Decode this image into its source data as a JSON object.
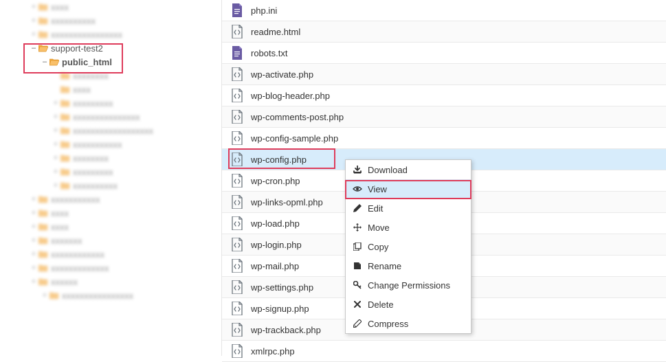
{
  "sidebar": {
    "items": [
      {
        "indent": 1,
        "toggle": "+",
        "label": "xxxx",
        "blur": true
      },
      {
        "indent": 1,
        "toggle": "+",
        "label": "xxxxxxxxxx",
        "blur": true
      },
      {
        "indent": 1,
        "toggle": "+",
        "label": "xxxxxxxxxxxxxxxx",
        "blur": true
      },
      {
        "indent": 1,
        "toggle": "–",
        "label": "support-test2",
        "blur": false,
        "open": true
      },
      {
        "indent": 2,
        "toggle": "–",
        "label": "public_html",
        "blur": false,
        "bold": true,
        "open": true
      },
      {
        "indent": 3,
        "toggle": "",
        "label": "xxxxxxxx",
        "blur": true
      },
      {
        "indent": 3,
        "toggle": "",
        "label": "xxxx",
        "blur": true
      },
      {
        "indent": 3,
        "toggle": "+",
        "label": "xxxxxxxxx",
        "blur": true
      },
      {
        "indent": 3,
        "toggle": "+",
        "label": "xxxxxxxxxxxxxxx",
        "blur": true
      },
      {
        "indent": 3,
        "toggle": "+",
        "label": "xxxxxxxxxxxxxxxxxx",
        "blur": true
      },
      {
        "indent": 3,
        "toggle": "+",
        "label": "xxxxxxxxxxx",
        "blur": true
      },
      {
        "indent": 3,
        "toggle": "+",
        "label": "xxxxxxxx",
        "blur": true
      },
      {
        "indent": 3,
        "toggle": "+",
        "label": "xxxxxxxxx",
        "blur": true
      },
      {
        "indent": 3,
        "toggle": "+",
        "label": "xxxxxxxxxx",
        "blur": true
      },
      {
        "indent": 1,
        "toggle": "+",
        "label": "xxxxxxxxxxx",
        "blur": true
      },
      {
        "indent": 1,
        "toggle": "+",
        "label": "xxxx",
        "blur": true
      },
      {
        "indent": 1,
        "toggle": "+",
        "label": "xxxx",
        "blur": true
      },
      {
        "indent": 1,
        "toggle": "+",
        "label": "xxxxxxx",
        "blur": true
      },
      {
        "indent": 1,
        "toggle": "+",
        "label": "xxxxxxxxxxxx",
        "blur": true
      },
      {
        "indent": 1,
        "toggle": "+",
        "label": "xxxxxxxxxxxxx",
        "blur": true
      },
      {
        "indent": 1,
        "toggle": "+",
        "label": "xxxxxx",
        "blur": true
      },
      {
        "indent": 2,
        "toggle": "+",
        "label": "xxxxxxxxxxxxxxxx",
        "blur": true
      }
    ]
  },
  "files": [
    {
      "name": "php.ini",
      "icon": "doc"
    },
    {
      "name": "readme.html",
      "icon": "code"
    },
    {
      "name": "robots.txt",
      "icon": "doc"
    },
    {
      "name": "wp-activate.php",
      "icon": "code"
    },
    {
      "name": "wp-blog-header.php",
      "icon": "code"
    },
    {
      "name": "wp-comments-post.php",
      "icon": "code"
    },
    {
      "name": "wp-config-sample.php",
      "icon": "code"
    },
    {
      "name": "wp-config.php",
      "icon": "code",
      "selected": true
    },
    {
      "name": "wp-cron.php",
      "icon": "code"
    },
    {
      "name": "wp-links-opml.php",
      "icon": "code"
    },
    {
      "name": "wp-load.php",
      "icon": "code"
    },
    {
      "name": "wp-login.php",
      "icon": "code"
    },
    {
      "name": "wp-mail.php",
      "icon": "code"
    },
    {
      "name": "wp-settings.php",
      "icon": "code"
    },
    {
      "name": "wp-signup.php",
      "icon": "code"
    },
    {
      "name": "wp-trackback.php",
      "icon": "code"
    },
    {
      "name": "xmlrpc.php",
      "icon": "code"
    }
  ],
  "contextMenu": {
    "items": [
      {
        "label": "Download",
        "icon": "download"
      },
      {
        "label": "View",
        "icon": "eye",
        "highlighted": true
      },
      {
        "label": "Edit",
        "icon": "pencil"
      },
      {
        "label": "Move",
        "icon": "move"
      },
      {
        "label": "Copy",
        "icon": "copy"
      },
      {
        "label": "Rename",
        "icon": "rename"
      },
      {
        "label": "Change Permissions",
        "icon": "key"
      },
      {
        "label": "Delete",
        "icon": "delete"
      },
      {
        "label": "Compress",
        "icon": "compress"
      }
    ]
  }
}
